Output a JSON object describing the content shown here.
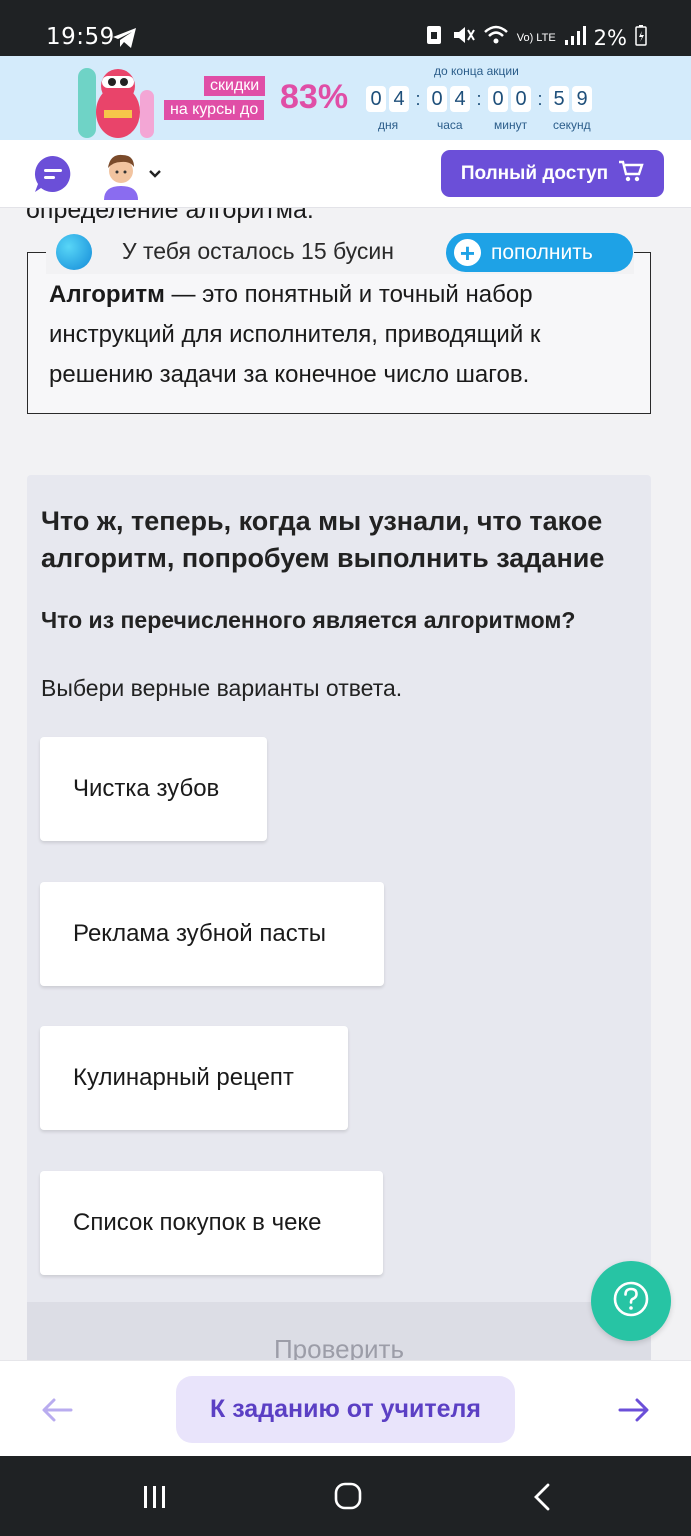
{
  "status_bar": {
    "time": "19:59",
    "battery": "2%",
    "network": "Vo) LTE"
  },
  "promo": {
    "tag_line1": "скидки",
    "tag_line2": "на курсы до",
    "percent": "83%",
    "until_label": "до конца акции",
    "timer_digits": [
      "0",
      "4",
      "0",
      "4",
      "0",
      "0",
      "5",
      "9"
    ],
    "timer_labels": [
      "дня",
      "часа",
      "минут",
      "секунд"
    ],
    "accent_color": "#e04ea6"
  },
  "header": {
    "full_access_label": "Полный доступ",
    "brand_color": "#6b4fd8"
  },
  "content": {
    "partial_heading": "определение алгоритма.",
    "beads_text": "У тебя осталось 15 бусин",
    "topup_label": "пополнить",
    "definition_term": "Алгоритм",
    "definition_rest": " — это понятный и точный набор инструкций для исполнителя, приводящий к решению задачи за конечное число шагов."
  },
  "task": {
    "title": "Что ж, теперь, когда мы узнали, что такое алгоритм, попробуем выполнить задание",
    "question": "Что из перечисленного является алгоритмом?",
    "instruction": "Выбери верные варианты ответа.",
    "options": [
      "Чистка зубов",
      "Реклама зубной пасты",
      "Кулинарный рецепт",
      "Список покупок в чеке"
    ],
    "check_label": "Проверить"
  },
  "bottom_nav": {
    "teacher_label": "К заданию от учителя"
  },
  "icons": {
    "menu": "chat-menu-icon",
    "cart": "cart-icon",
    "help": "question-icon",
    "prev": "arrow-left-icon",
    "next": "arrow-right-icon"
  }
}
